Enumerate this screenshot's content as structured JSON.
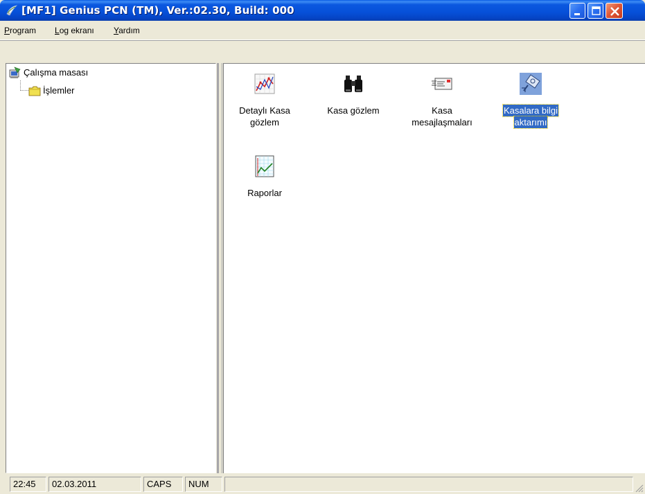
{
  "window": {
    "title": "[MF1] Genius PCN (TM), Ver.:02.30, Build: 000"
  },
  "menu": {
    "items": [
      {
        "first": "P",
        "rest": "rogram"
      },
      {
        "first": "L",
        "rest": "og ekranı"
      },
      {
        "first": "Y",
        "rest": "ardım"
      }
    ]
  },
  "tree": {
    "root_label": "Çalışma masası",
    "child_label": "İşlemler"
  },
  "icons": [
    {
      "line1": "Detaylı Kasa",
      "line2": "gözlem",
      "icon": "chart-icon",
      "selected": false
    },
    {
      "line1": "Kasa gözlem",
      "line2": "",
      "icon": "binoculars-icon",
      "selected": false
    },
    {
      "line1": "Kasa",
      "line2": "mesajlaşmaları",
      "icon": "message-icon",
      "selected": false
    },
    {
      "line1": "Kasalara bilgi",
      "line2": "aktarımı",
      "icon": "transfer-icon",
      "selected": true
    },
    {
      "line1": "Raporlar",
      "line2": "",
      "icon": "report-icon",
      "selected": false
    }
  ],
  "status": {
    "time": "22:45",
    "date": "02.03.2011",
    "caps": "CAPS",
    "num": "NUM"
  },
  "colors": {
    "titlebar": "#0650d8",
    "selection": "#316ac5",
    "chrome": "#ece9d8"
  }
}
